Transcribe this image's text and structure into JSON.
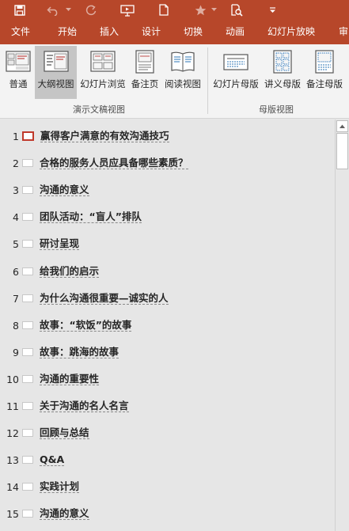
{
  "toolbar": {
    "icons": [
      "save-icon",
      "undo-icon",
      "redo-icon",
      "present-from-start-icon",
      "new-file-icon",
      "star-icon",
      "print-preview-icon",
      "customize-toolbar-icon"
    ]
  },
  "tabs": [
    {
      "label": "文件",
      "active": false
    },
    {
      "label": "开始",
      "active": false
    },
    {
      "label": "插入",
      "active": false
    },
    {
      "label": "设计",
      "active": false
    },
    {
      "label": "切换",
      "active": false
    },
    {
      "label": "动画",
      "active": false
    },
    {
      "label": "幻灯片放映",
      "active": false
    },
    {
      "label": "审",
      "active": false
    }
  ],
  "ribbon": {
    "presentation_views": {
      "group_label": "演示文稿视图",
      "buttons": [
        {
          "label": "普通",
          "icon": "normal-view-icon",
          "selected": false
        },
        {
          "label": "大纲视图",
          "icon": "outline-view-icon",
          "selected": true
        },
        {
          "label": "幻灯片浏览",
          "icon": "slide-sorter-icon",
          "selected": false
        },
        {
          "label": "备注页",
          "icon": "notes-page-icon",
          "selected": false
        },
        {
          "label": "阅读视图",
          "icon": "reading-view-icon",
          "selected": false
        }
      ]
    },
    "master_views": {
      "group_label": "母版视图",
      "buttons": [
        {
          "label": "幻灯片母版",
          "icon": "slide-master-icon"
        },
        {
          "label": "讲义母版",
          "icon": "handout-master-icon"
        },
        {
          "label": "备注母版",
          "icon": "notes-master-icon"
        }
      ]
    }
  },
  "outline": {
    "selected_slide": 1,
    "slides": [
      {
        "num": "1",
        "title": "赢得客户满意的有效沟通技巧"
      },
      {
        "num": "2",
        "title": "合格的服务人员应具备哪些素质？"
      },
      {
        "num": "3",
        "title": "沟通的意义"
      },
      {
        "num": "4",
        "title": "团队活动：“盲人”排队"
      },
      {
        "num": "5",
        "title": "研讨呈现"
      },
      {
        "num": "6",
        "title": "给我们的启示"
      },
      {
        "num": "7",
        "title": "为什么沟通很重要—诚实的人"
      },
      {
        "num": "8",
        "title": "故事：“软饭”的故事"
      },
      {
        "num": "9",
        "title": "故事：跳海的故事"
      },
      {
        "num": "10",
        "title": "沟通的重要性"
      },
      {
        "num": "11",
        "title": "关于沟通的名人名言"
      },
      {
        "num": "12",
        "title": "回顾与总结"
      },
      {
        "num": "13",
        "title": "Q&A"
      },
      {
        "num": "14",
        "title": "实践计划"
      },
      {
        "num": "15",
        "title": "沟通的意义"
      }
    ]
  }
}
